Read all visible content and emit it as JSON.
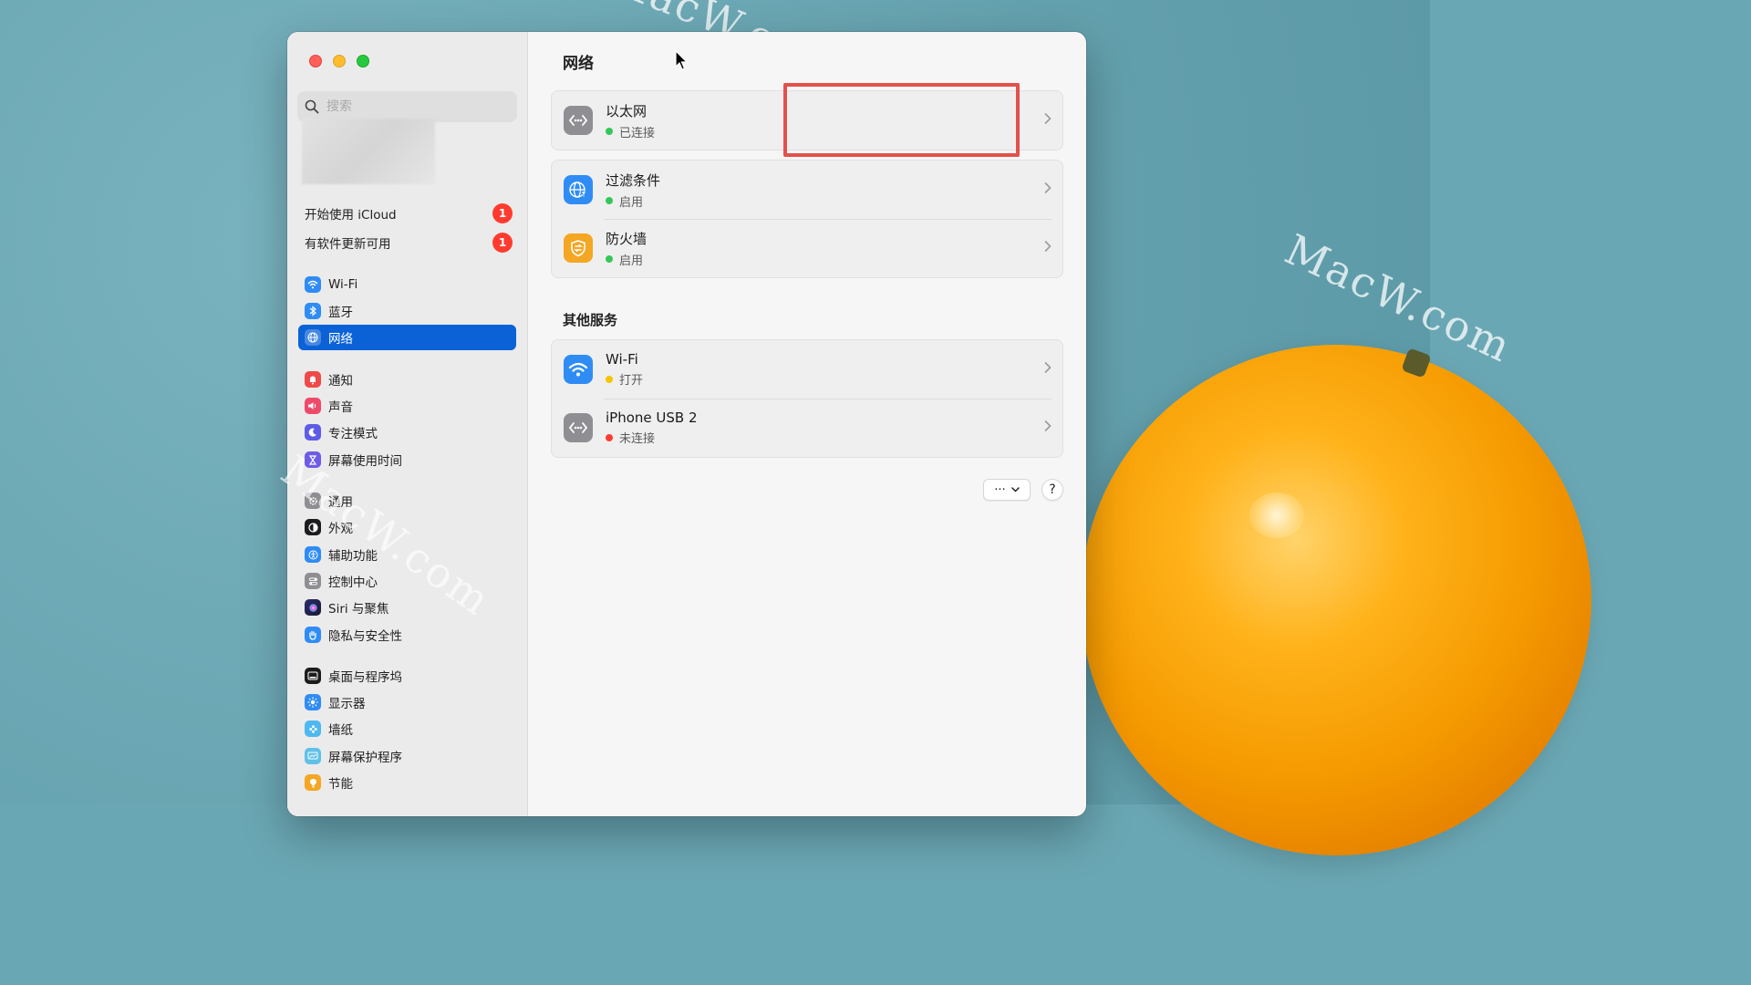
{
  "watermark": "MacW.com",
  "search": {
    "placeholder": "搜索"
  },
  "notices": [
    {
      "label": "开始使用 iCloud",
      "badge": "1"
    },
    {
      "label": "有软件更新可用",
      "badge": "1"
    }
  ],
  "sidebar": {
    "items": [
      {
        "label": "Wi-Fi",
        "icon": "wifi-icon",
        "color": "#2f8cf5"
      },
      {
        "label": "蓝牙",
        "icon": "bluetooth-icon",
        "color": "#2f8cf5"
      },
      {
        "label": "网络",
        "icon": "globe-icon",
        "color": "#2f8cf5"
      },
      {
        "label": "通知",
        "icon": "bell-icon",
        "color": "#ef4a4a"
      },
      {
        "label": "声音",
        "icon": "speaker-icon",
        "color": "#ef4a6a"
      },
      {
        "label": "专注模式",
        "icon": "moon-icon",
        "color": "#5e5ce6"
      },
      {
        "label": "屏幕使用时间",
        "icon": "hourglass-icon",
        "color": "#6e5ce6"
      },
      {
        "label": "通用",
        "icon": "gear-icon",
        "color": "#8e8e93"
      },
      {
        "label": "外观",
        "icon": "appearance-icon",
        "color": "#1c1c1e"
      },
      {
        "label": "辅助功能",
        "icon": "accessibility-icon",
        "color": "#2f8cf5"
      },
      {
        "label": "控制中心",
        "icon": "control-center-icon",
        "color": "#8e8e93"
      },
      {
        "label": "Siri 与聚焦",
        "icon": "siri-icon",
        "color": "#3a3a6e"
      },
      {
        "label": "隐私与安全性",
        "icon": "hand-icon",
        "color": "#2f8cf5"
      },
      {
        "label": "桌面与程序坞",
        "icon": "dock-icon",
        "color": "#1c1c1e"
      },
      {
        "label": "显示器",
        "icon": "display-icon",
        "color": "#2f8cf5"
      },
      {
        "label": "墙纸",
        "icon": "wallpaper-icon",
        "color": "#4fb8f0"
      },
      {
        "label": "屏幕保护程序",
        "icon": "screensaver-icon",
        "color": "#5fc0e8"
      },
      {
        "label": "节能",
        "icon": "bulb-icon",
        "color": "#f5a623"
      }
    ],
    "selected": "网络"
  },
  "main": {
    "title": "网络",
    "services": [
      {
        "name": "以太网",
        "status": "已连接",
        "status_color": "#34c759",
        "icon": "ethernet-icon",
        "icon_color": "#8e8e93"
      },
      {
        "name": "过滤条件",
        "status": "启用",
        "status_color": "#34c759",
        "icon": "globe-filter-icon",
        "icon_color": "#2f8cf5"
      },
      {
        "name": "防火墙",
        "status": "启用",
        "status_color": "#34c759",
        "icon": "firewall-icon",
        "icon_color": "#f5a623"
      }
    ],
    "other_title": "其他服务",
    "other_services": [
      {
        "name": "Wi-Fi",
        "status": "打开",
        "status_color": "#f5c400",
        "icon": "wifi-icon",
        "icon_color": "#2f8cf5"
      },
      {
        "name": "iPhone USB 2",
        "status": "未连接",
        "status_color": "#ff3b30",
        "icon": "ethernet-icon",
        "icon_color": "#8e8e93"
      }
    ],
    "more_label": "···",
    "help_label": "?"
  }
}
